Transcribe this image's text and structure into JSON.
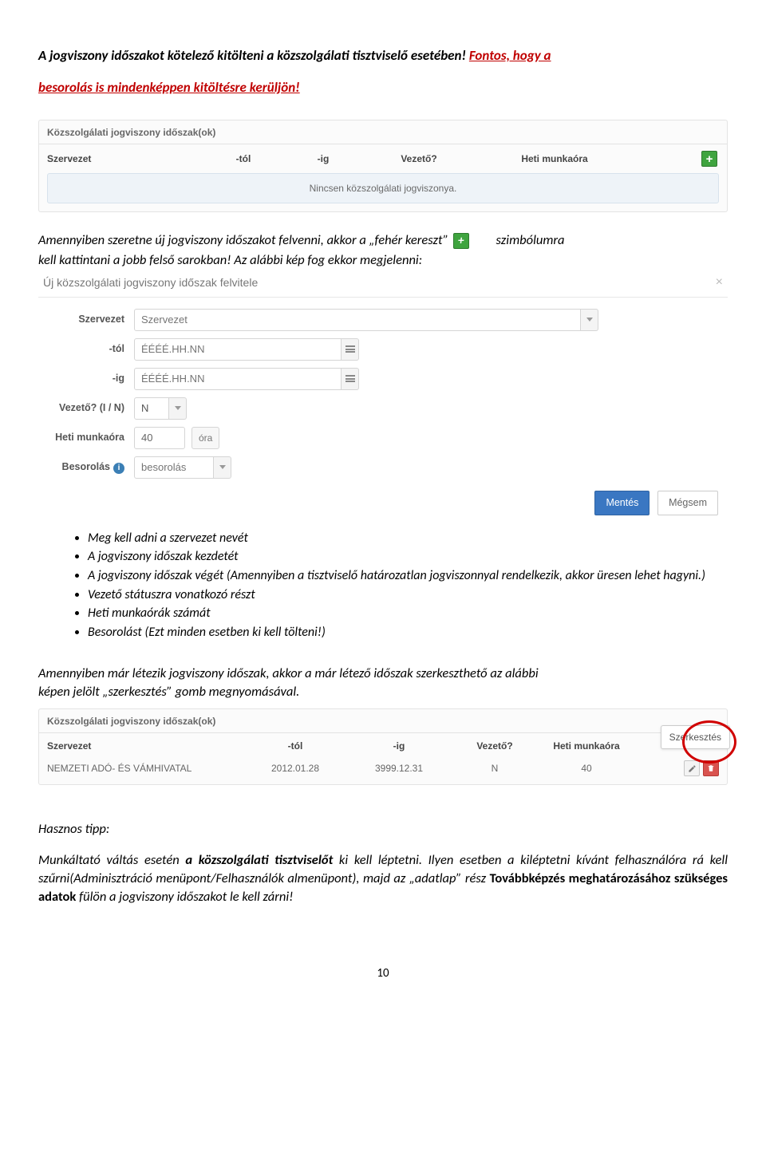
{
  "warn_line1_a": "A jogviszony időszakot kötelező kitölteni a közszolgálati tisztviselő esetében! ",
  "warn_line1_b": "Fontos, hogy a",
  "warn_line2": "besorolás is mindenképpen kitöltésre kerüljön!",
  "panel1": {
    "title": "Közszolgálati jogviszony időszak(ok)",
    "headers": {
      "szervezet": "Szervezet",
      "tol": "-tól",
      "ig": "-ig",
      "vezeto": "Vezető?",
      "heti": "Heti munkaóra"
    },
    "empty": "Nincsen közszolgálati jogviszonya."
  },
  "para_inline_a": "Amennyiben szeretne új jogviszony időszakot felvenni, akkor a „fehér kereszt”",
  "para_inline_b": "szimbólumra",
  "para_inline_c": "kell kattintani a jobb felső sarokban! Az alábbi kép fog ekkor megjelenni:",
  "dialog": {
    "title": "Új közszolgálati jogviszony időszak felvitele",
    "labels": {
      "szervezet": "Szervezet",
      "tol": "-tól",
      "ig": "-ig",
      "vezeto": "Vezető? (I / N)",
      "heti": "Heti munkaóra",
      "besorolas": "Besorolás"
    },
    "placeholders": {
      "szervezet": "Szervezet",
      "date": "ÉÉÉÉ.HH.NN",
      "vezeto": "N",
      "heti": "40",
      "ora": "óra",
      "besorolas": "besorolás"
    },
    "buttons": {
      "save": "Mentés",
      "cancel": "Mégsem"
    }
  },
  "reqs": [
    "Meg kell adni a szervezet nevét",
    "A jogviszony időszak kezdetét",
    "A jogviszony időszak végét (Amennyiben a tisztviselő határozatlan jogviszonnyal rendelkezik, akkor üresen lehet hagyni.)",
    "Vezető státuszra vonatkozó részt",
    "Heti munkaórák számát",
    "Besorolást (Ezt minden esetben ki kell tölteni!)"
  ],
  "para2_a": "Amennyiben már létezik jogviszony időszak, akkor a már létező időszak szerkeszthető az alábbi",
  "para2_b": "képen jelölt „szerkesztés” gomb megnyomásával.",
  "panel2": {
    "title": "Közszolgálati jogviszony időszak(ok)",
    "headers": {
      "szervezet": "Szervezet",
      "tol": "-tól",
      "ig": "-ig",
      "vezeto": "Vezető?",
      "heti": "Heti munkaóra"
    },
    "row": {
      "szervezet": "NEMZETI ADÓ- ÉS VÁMHIVATAL",
      "tol": "2012.01.28",
      "ig": "3999.12.31",
      "vezeto": "N",
      "heti": "40"
    },
    "tooltip": "Szerkesztés"
  },
  "tip": {
    "head": "Hasznos tipp:",
    "body_a": "Munkáltató váltás esetén ",
    "body_b": "a közszolgálati tisztviselőt",
    "body_c": " ki kell léptetni. Ilyen esetben a kiléptetni kívánt felhasználóra rá kell szűrni(Adminisztráció menüpont/Felhasználók almenüpont), majd az „adatlap” rész ",
    "body_d": "Továbbképzés meghatározásához szükséges adatok",
    "body_e": " fülön a jogviszony időszakot le kell zárni!"
  },
  "page_number": "10"
}
